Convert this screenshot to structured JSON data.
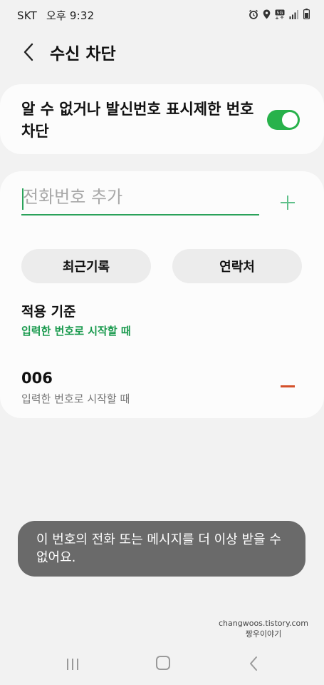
{
  "status_bar": {
    "carrier": "SKT",
    "time": "오후 9:32",
    "icons": [
      "alarm-icon",
      "location-icon",
      "5g-icon",
      "signal-icon",
      "battery-icon"
    ]
  },
  "header": {
    "back_icon": "chevron-left-icon",
    "title": "수신 차단"
  },
  "unknown_block": {
    "label": "알 수 없거나 발신번호 표시제한 번호 차단",
    "enabled": true
  },
  "phone_input": {
    "placeholder": "전화번호 추가",
    "value": ""
  },
  "buttons": {
    "recent": "최근기록",
    "contacts": "연락처"
  },
  "criteria": {
    "title": "적용 기준",
    "value": "입력한 번호로 시작할 때"
  },
  "blocked_entries": [
    {
      "number": "006",
      "description": "입력한 번호로 시작할 때"
    }
  ],
  "toast": {
    "message": "이 번호의 전화 또는 메시지를 더 이상 받을 수 없어요."
  },
  "watermark": {
    "line1": "changwoos.tistory.com",
    "line2": "짱우이야기"
  },
  "colors": {
    "accent": "#28b24b",
    "accent_text": "#1a9a4e",
    "remove": "#d4502a",
    "toast_bg": "#6a6a6a"
  }
}
